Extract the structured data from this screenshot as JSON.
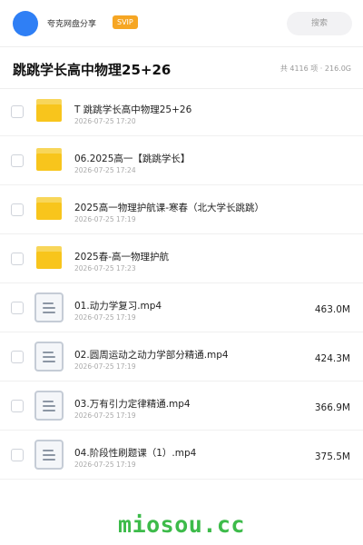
{
  "topbar": {
    "sharer_name": "夸克网盘分享",
    "badge": "SVIP",
    "search_placeholder": "搜索"
  },
  "header": {
    "title": "跳跳学长高中物理25+26",
    "stats": "共 4116 项 · 216.0G"
  },
  "files": [
    {
      "name": "T 跳跳学长高中物理25+26",
      "date": "2026-07-25 17:20",
      "size": "",
      "type": "folder"
    },
    {
      "name": "06.2025高一【跳跳学长】",
      "date": "2026-07-25 17:24",
      "size": "",
      "type": "folder"
    },
    {
      "name": "2025高一物理护航课-寒春（北大学长跳跳）",
      "date": "2026-07-25 17:19",
      "size": "",
      "type": "folder"
    },
    {
      "name": "2025春-高一物理护航",
      "date": "2026-07-25 17:23",
      "size": "",
      "type": "folder"
    },
    {
      "name": "01.动力学复习.mp4",
      "date": "2026-07-25 17:19",
      "size": "463.0M",
      "type": "file"
    },
    {
      "name": "02.圆周运动之动力学部分精通.mp4",
      "date": "2026-07-25 17:19",
      "size": "424.3M",
      "type": "file"
    },
    {
      "name": "03.万有引力定律精通.mp4",
      "date": "2026-07-25 17:19",
      "size": "366.9M",
      "type": "file"
    },
    {
      "name": "04.阶段性刷题课（1）.mp4",
      "date": "2026-07-25 17:19",
      "size": "375.5M",
      "type": "file"
    }
  ],
  "watermark": "miosou.cc",
  "colors": {
    "avatar": "#2f7ff5",
    "badge": "#f6a623",
    "folder": "#f8c51c",
    "watermark": "#3dbb4a"
  }
}
